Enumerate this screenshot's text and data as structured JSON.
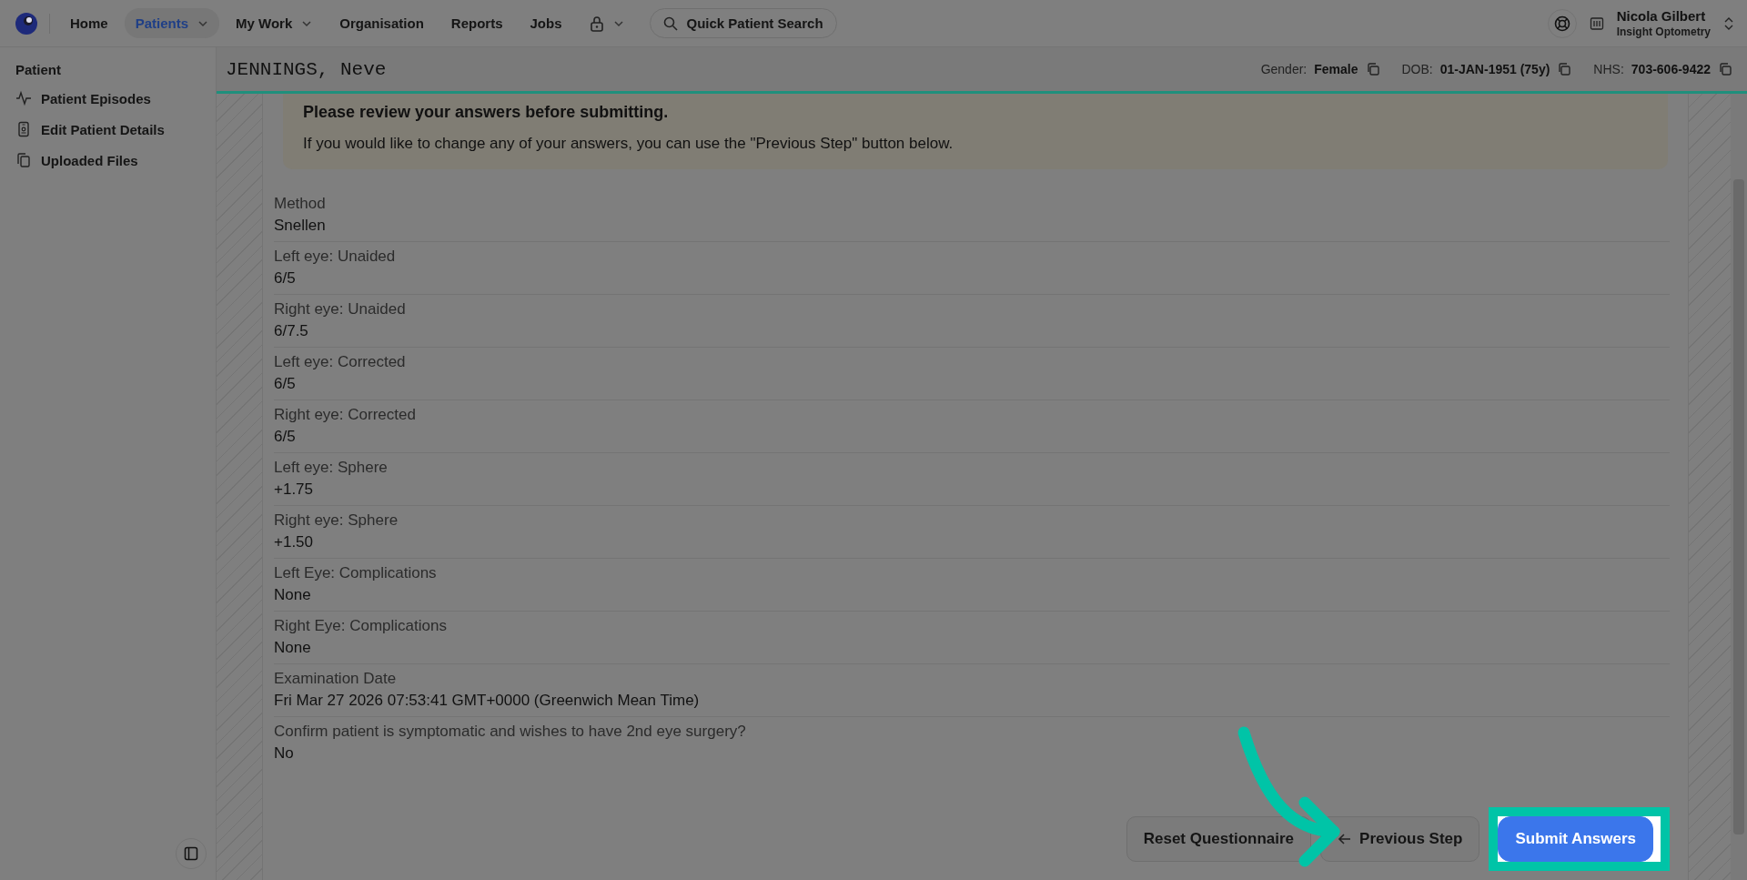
{
  "nav": {
    "items": [
      {
        "label": "Home",
        "selected": false,
        "dropdown": false
      },
      {
        "label": "Patients",
        "selected": true,
        "dropdown": true
      },
      {
        "label": "My Work",
        "selected": false,
        "dropdown": true
      },
      {
        "label": "Organisation",
        "selected": false,
        "dropdown": false
      },
      {
        "label": "Reports",
        "selected": false,
        "dropdown": false
      },
      {
        "label": "Jobs",
        "selected": false,
        "dropdown": false
      }
    ],
    "search": "Quick Patient Search"
  },
  "user": {
    "name": "Nicola Gilbert",
    "organisation": "Insight Optometry"
  },
  "sidebar": {
    "heading": "Patient",
    "items": [
      {
        "label": "Patient Episodes",
        "kind": "activity"
      },
      {
        "label": "Edit Patient Details",
        "kind": "card"
      },
      {
        "label": "Uploaded Files",
        "kind": "files"
      }
    ]
  },
  "patient": {
    "name": "JENNINGS, Neve",
    "fields": [
      {
        "label": "Gender:",
        "value": "Female"
      },
      {
        "label": "DOB:",
        "value": "01-JAN-1951 (75y)"
      },
      {
        "label": "NHS:",
        "value": "703-606-9422"
      }
    ]
  },
  "alert": {
    "title": "Please review your answers before submitting.",
    "text": "If you would like to change any of your answers, you can use the \"Previous Step\" button below."
  },
  "answers": [
    {
      "question": "Method",
      "answer": "Snellen"
    },
    {
      "question": "Left eye: Unaided",
      "answer": "6/5"
    },
    {
      "question": "Right eye: Unaided",
      "answer": "6/7.5"
    },
    {
      "question": "Left eye: Corrected",
      "answer": "6/5"
    },
    {
      "question": "Right eye: Corrected",
      "answer": "6/5"
    },
    {
      "question": "Left eye: Sphere",
      "answer": "+1.75"
    },
    {
      "question": "Right eye: Sphere",
      "answer": "+1.50"
    },
    {
      "question": "Left Eye: Complications",
      "answer": "None"
    },
    {
      "question": "Right Eye: Complications",
      "answer": "None"
    },
    {
      "question": "Examination Date",
      "answer": "Fri Mar 27 2026 07:53:41 GMT+0000 (Greenwich Mean Time)"
    },
    {
      "question": "Confirm patient is symptomatic and wishes to have 2nd eye surgery?",
      "answer": "No"
    }
  ],
  "buttons": [
    {
      "label": "Reset Questionnaire",
      "kind": "secondary",
      "highlighted": false
    },
    {
      "label": "Previous Step",
      "kind": "back",
      "highlighted": false
    },
    {
      "label": "Submit Answers",
      "kind": "primary",
      "highlighted": true
    }
  ]
}
